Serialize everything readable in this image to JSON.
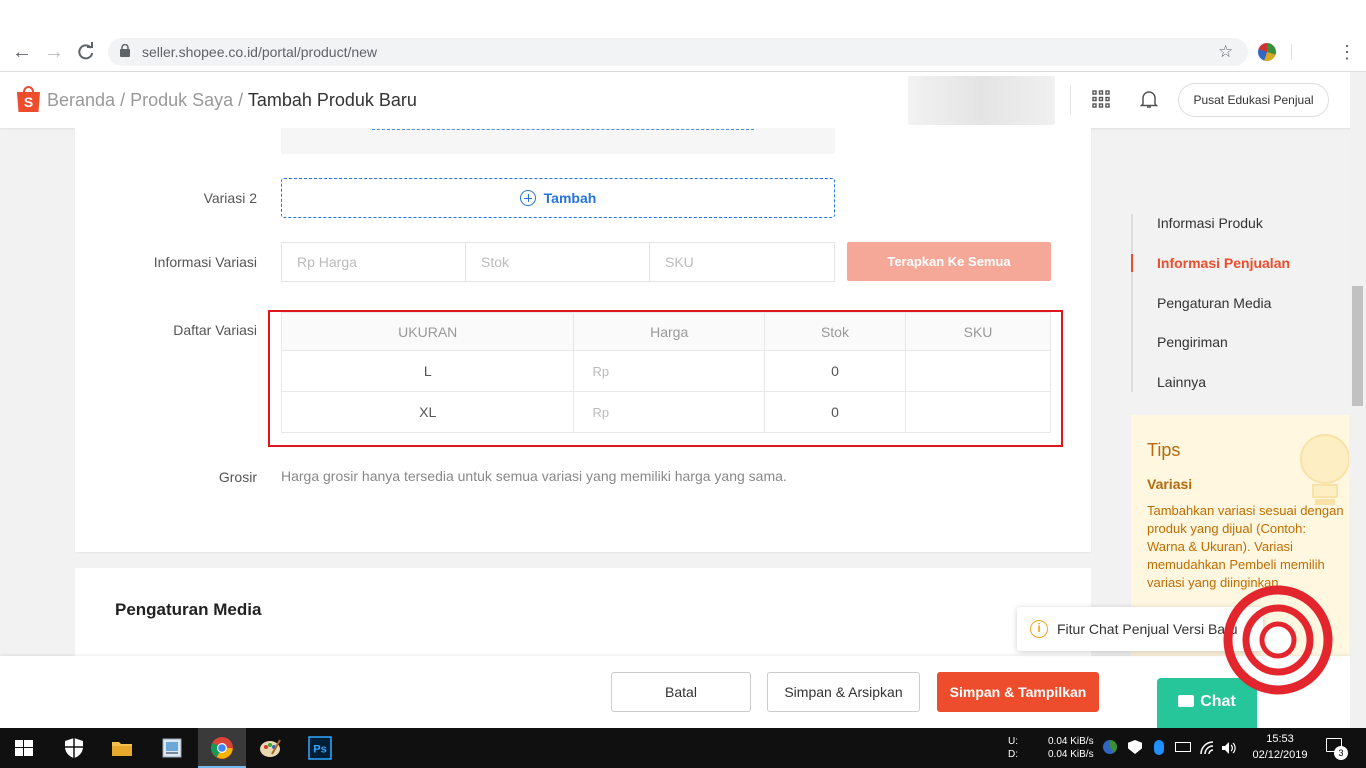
{
  "browser": {
    "url": "seller.shopee.co.id/portal/product/new"
  },
  "header": {
    "breadcrumb_home": "Beranda",
    "sep1": " / ",
    "breadcrumb_products": "Produk Saya",
    "sep2": " / ",
    "breadcrumb_current": "Tambah Produk Baru",
    "edu_button": "Pusat Edukasi Penjual"
  },
  "form": {
    "variasi2_label": "Variasi 2",
    "tambah_label": "Tambah",
    "info_variasi_label": "Informasi Variasi",
    "harga_placeholder": "Rp Harga",
    "stok_placeholder": "Stok",
    "sku_placeholder": "SKU",
    "apply_button": "Terapkan Ke Semua",
    "daftar_variasi_label": "Daftar Variasi",
    "table": {
      "headers": [
        "UKURAN",
        "Harga",
        "Stok",
        "SKU"
      ],
      "rows": [
        {
          "ukuran": "L",
          "harga": "Rp",
          "stok": "0",
          "sku": ""
        },
        {
          "ukuran": "XL",
          "harga": "Rp",
          "stok": "0",
          "sku": ""
        }
      ]
    },
    "grosir_label": "Grosir",
    "grosir_text": "Harga grosir hanya tersedia untuk semua variasi yang memiliki harga yang sama."
  },
  "media_section_title": "Pengaturan Media",
  "sidenav": {
    "items": [
      "Informasi Produk",
      "Informasi Penjualan",
      "Pengaturan Media",
      "Pengiriman",
      "Lainnya"
    ],
    "active_index": 1
  },
  "tips": {
    "title": "Tips",
    "subtitle": "Variasi",
    "body": "Tambahkan variasi sesuai dengan produk yang dijual (Contoh: Warna & Ukuran). Variasi memudahkan Pembeli memilih variasi yang diinginkan."
  },
  "footer": {
    "batal": "Batal",
    "arsip": "Simpan & Arsipkan",
    "tampil": "Simpan & Tampilkan"
  },
  "chat": {
    "popup_text": "Fitur Chat Penjual Versi Baru",
    "button": "Chat"
  },
  "taskbar": {
    "net_up_label": "U:",
    "net_down_label": "D:",
    "net_up": "0.04 KiB/s",
    "net_down": "0.04 KiB/s",
    "time": "15:53",
    "date": "02/12/2019",
    "notification_count": "3"
  },
  "colors": {
    "brand": "#ee4d2d",
    "link": "#2673dd",
    "highlight_box": "#e0161e",
    "chat": "#27c59a"
  }
}
